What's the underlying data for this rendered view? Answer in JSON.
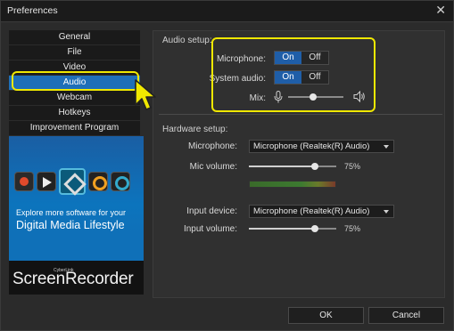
{
  "window": {
    "title": "Preferences",
    "close_glyph": "✕"
  },
  "nav": {
    "items": [
      {
        "label": "General",
        "active": false
      },
      {
        "label": "File",
        "active": false
      },
      {
        "label": "Video",
        "active": false
      },
      {
        "label": "Audio",
        "active": true
      },
      {
        "label": "Webcam",
        "active": false
      },
      {
        "label": "Hotkeys",
        "active": false
      },
      {
        "label": "Improvement Program",
        "active": false
      }
    ]
  },
  "banner": {
    "line1": "Explore more software for your",
    "line2": "Digital Media Lifestyle",
    "brand_small": "CyberLink",
    "brand": "ScreenRecorder"
  },
  "audio_setup": {
    "title": "Audio setup:",
    "microphone_label": "Microphone:",
    "system_audio_label": "System audio:",
    "mix_label": "Mix:",
    "on_label": "On",
    "off_label": "Off",
    "microphone_state": "On",
    "system_audio_state": "On",
    "mix_level": 0.45
  },
  "hardware_setup": {
    "title": "Hardware setup:",
    "microphone_label": "Microphone:",
    "microphone_value": "Microphone (Realtek(R) Audio)",
    "mic_volume_label": "Mic volume:",
    "mic_volume_text": "75%",
    "mic_volume": 0.75,
    "input_device_label": "Input device:",
    "input_device_value": "Microphone (Realtek(R) Audio)",
    "input_volume_label": "Input volume:",
    "input_volume_text": "75%",
    "input_volume": 0.75
  },
  "footer": {
    "ok_label": "OK",
    "cancel_label": "Cancel"
  },
  "colors": {
    "accent": "#1f6fb8",
    "highlight": "#f0e800"
  },
  "icons": [
    "close-icon",
    "microphone-icon",
    "speaker-icon",
    "mouse-cursor-icon",
    "dropdown-arrow-icon"
  ]
}
